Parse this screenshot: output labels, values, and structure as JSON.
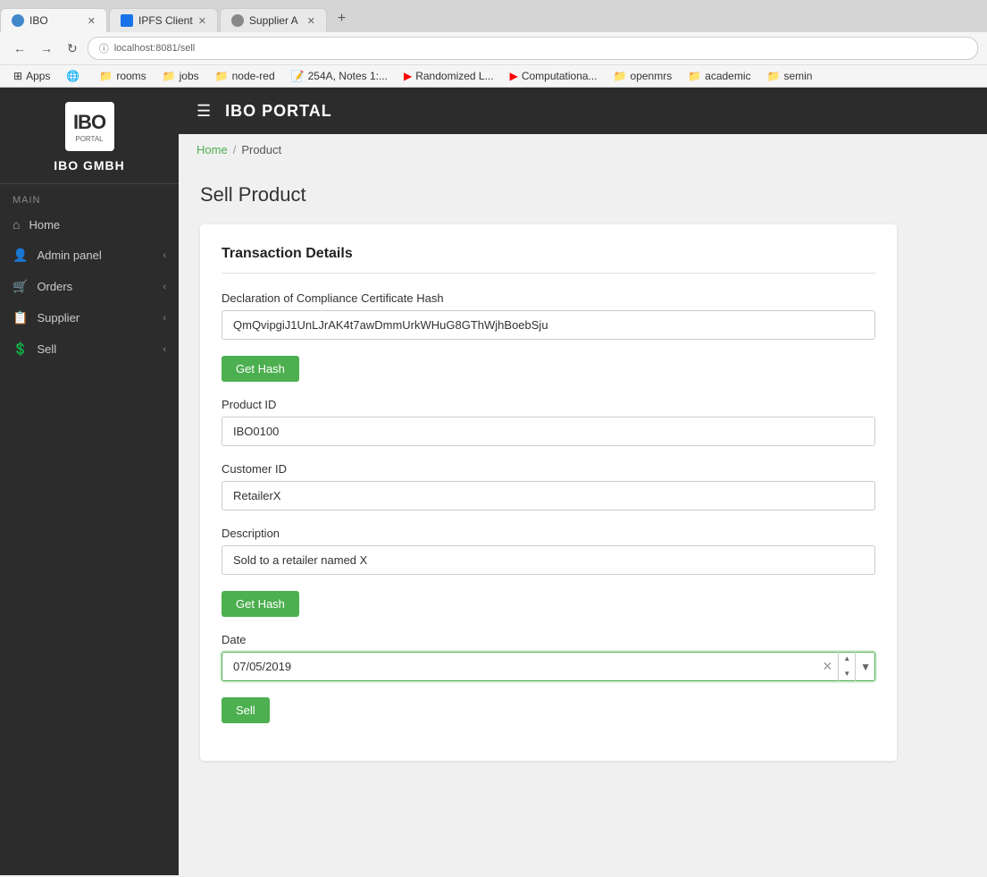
{
  "browser": {
    "tabs": [
      {
        "id": "tab-ibo",
        "favicon": "globe",
        "title": "IBO",
        "active": true,
        "closeable": true
      },
      {
        "id": "tab-ipfs",
        "favicon": "ipfs",
        "title": "IPFS Client",
        "active": false,
        "closeable": true
      },
      {
        "id": "tab-supplier",
        "favicon": "supplier",
        "title": "Supplier A",
        "active": false,
        "closeable": true
      }
    ],
    "address": "localhost:8081/sell",
    "address_prefix": "ⓘ"
  },
  "bookmarks": [
    {
      "id": "bm-apps",
      "icon": "⊞",
      "label": "Apps"
    },
    {
      "id": "bm-globe",
      "icon": "🌐",
      "label": ""
    },
    {
      "id": "bm-rooms",
      "icon": "📁",
      "label": "rooms"
    },
    {
      "id": "bm-jobs",
      "icon": "📁",
      "label": "jobs"
    },
    {
      "id": "bm-node-red",
      "icon": "📁",
      "label": "node-red"
    },
    {
      "id": "bm-254a",
      "icon": "📝",
      "label": "254A, Notes 1:..."
    },
    {
      "id": "bm-randomized",
      "icon": "▶",
      "label": "Randomized L..."
    },
    {
      "id": "bm-computational",
      "icon": "▶",
      "label": "Computationa..."
    },
    {
      "id": "bm-openmrs",
      "icon": "📁",
      "label": "openmrs"
    },
    {
      "id": "bm-academic",
      "icon": "📁",
      "label": "academic"
    },
    {
      "id": "bm-semin",
      "icon": "📁",
      "label": "semin"
    }
  ],
  "sidebar": {
    "logo_text": "IBO",
    "logo_sub": "PORTAL",
    "brand_name": "IBO GMBH",
    "section_label": "MAIN",
    "items": [
      {
        "id": "home",
        "icon": "⌂",
        "label": "Home",
        "has_chevron": false
      },
      {
        "id": "admin-panel",
        "icon": "👤",
        "label": "Admin panel",
        "has_chevron": true
      },
      {
        "id": "orders",
        "icon": "🛒",
        "label": "Orders",
        "has_chevron": true
      },
      {
        "id": "supplier",
        "icon": "📋",
        "label": "Supplier",
        "has_chevron": true
      },
      {
        "id": "sell",
        "icon": "💲",
        "label": "Sell",
        "has_chevron": true
      }
    ]
  },
  "topbar": {
    "title": "IBO PORTAL"
  },
  "breadcrumb": {
    "home": "Home",
    "separator": "/",
    "current": "Product"
  },
  "page": {
    "title": "Sell Product",
    "card": {
      "section_title": "Transaction Details",
      "fields": {
        "compliance_label": "Declaration of Compliance Certificate Hash",
        "compliance_value": "QmQvipgiJ1UnLJrAK4t7awDmmUrkWHuG8GThWjhBoebSju",
        "get_hash_label": "Get Hash",
        "product_id_label": "Product ID",
        "product_id_value": "IBO0100",
        "customer_id_label": "Customer ID",
        "customer_id_value": "RetailerX",
        "description_label": "Description",
        "description_value": "Sold to a retailer named X",
        "get_hash2_label": "Get Hash",
        "date_label": "Date",
        "date_value": "07/05/2019",
        "sell_button": "Sell"
      }
    }
  }
}
